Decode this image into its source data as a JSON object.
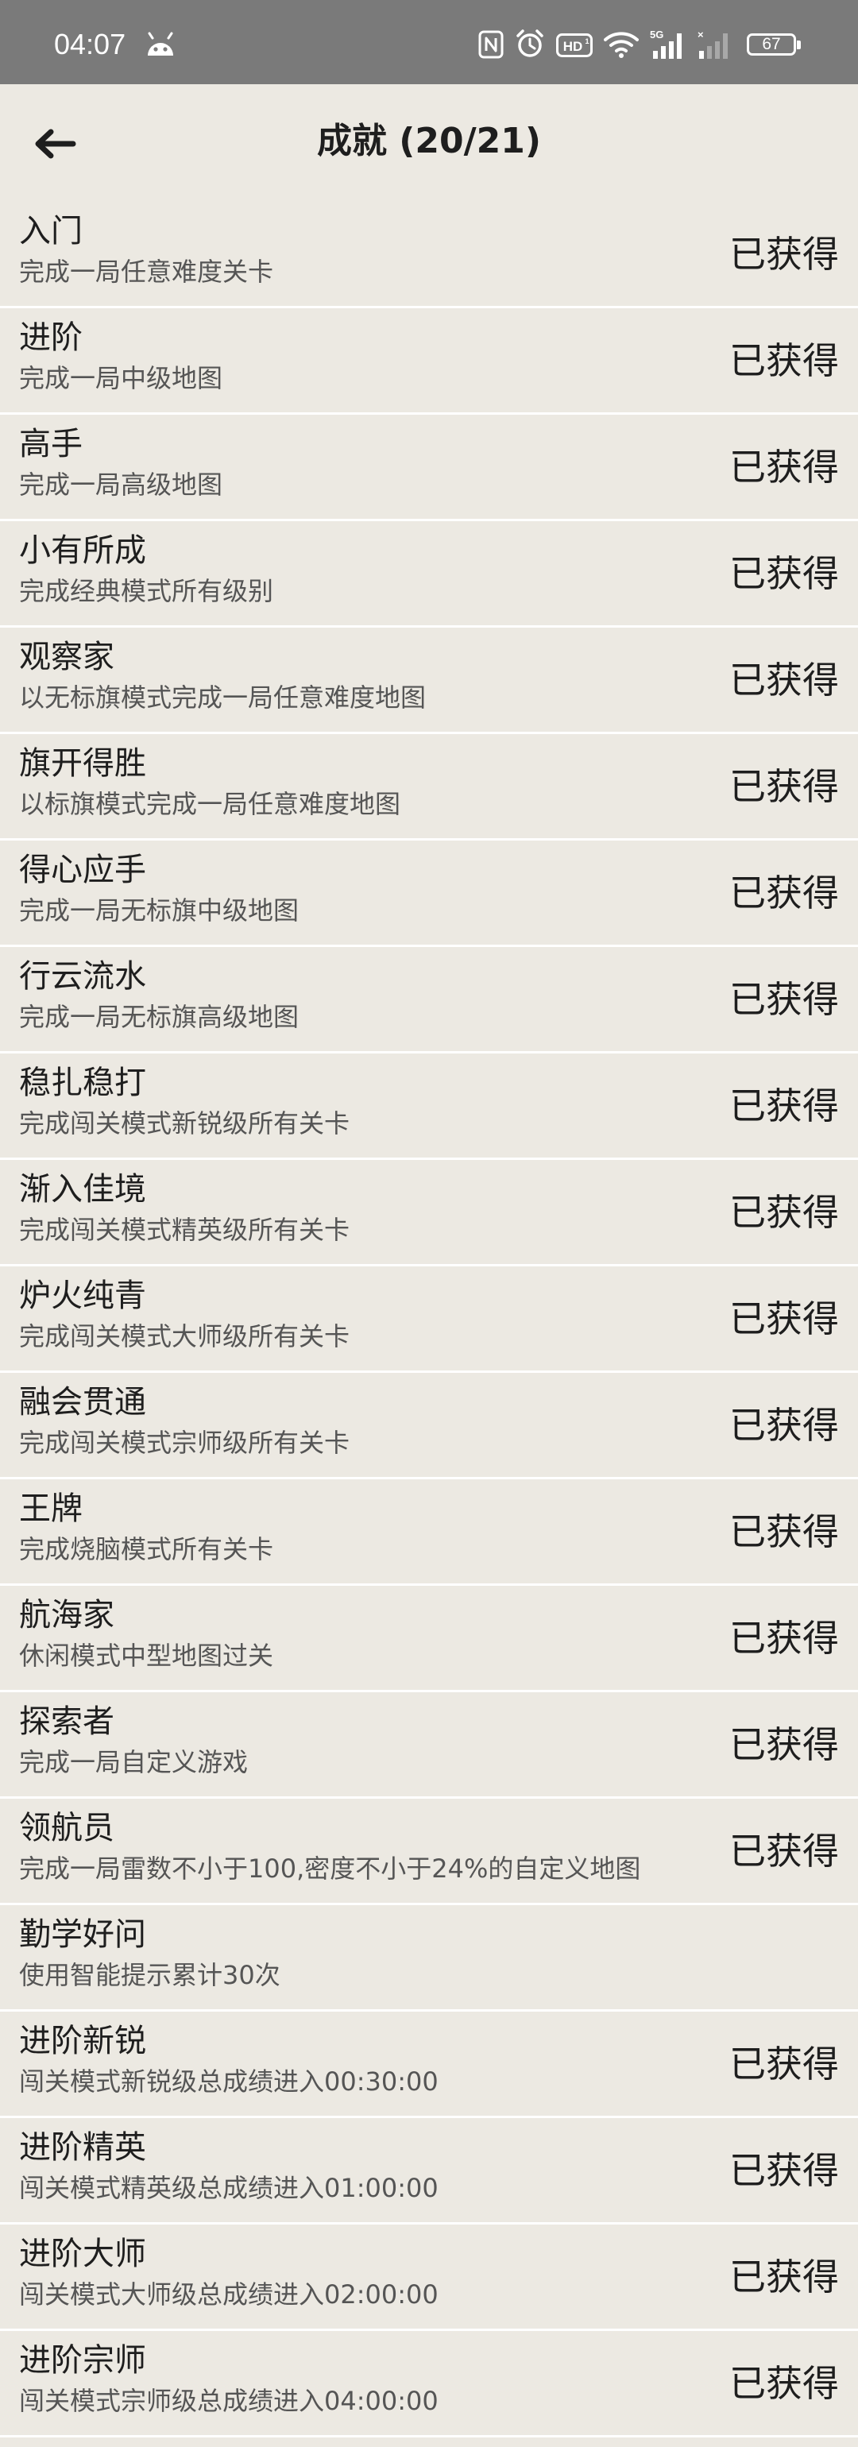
{
  "status_bar": {
    "time": "04:07",
    "battery": "67",
    "icons": [
      "android-icon",
      "nfc-icon",
      "alarm-icon",
      "hd-icon",
      "wifi-icon",
      "signal-5g-icon",
      "signal-icon",
      "battery-icon"
    ]
  },
  "header": {
    "title": "成就 (20/21)",
    "back_icon": "arrow-left-icon"
  },
  "achievements": [
    {
      "name": "入门",
      "desc": "完成一局任意难度关卡",
      "status": "已获得"
    },
    {
      "name": "进阶",
      "desc": "完成一局中级地图",
      "status": "已获得"
    },
    {
      "name": "高手",
      "desc": "完成一局高级地图",
      "status": "已获得"
    },
    {
      "name": "小有所成",
      "desc": "完成经典模式所有级别",
      "status": "已获得"
    },
    {
      "name": "观察家",
      "desc": "以无标旗模式完成一局任意难度地图",
      "status": "已获得"
    },
    {
      "name": "旗开得胜",
      "desc": "以标旗模式完成一局任意难度地图",
      "status": "已获得"
    },
    {
      "name": "得心应手",
      "desc": "完成一局无标旗中级地图",
      "status": "已获得"
    },
    {
      "name": "行云流水",
      "desc": "完成一局无标旗高级地图",
      "status": "已获得"
    },
    {
      "name": "稳扎稳打",
      "desc": "完成闯关模式新锐级所有关卡",
      "status": "已获得"
    },
    {
      "name": "渐入佳境",
      "desc": "完成闯关模式精英级所有关卡",
      "status": "已获得"
    },
    {
      "name": "炉火纯青",
      "desc": "完成闯关模式大师级所有关卡",
      "status": "已获得"
    },
    {
      "name": "融会贯通",
      "desc": "完成闯关模式宗师级所有关卡",
      "status": "已获得"
    },
    {
      "name": "王牌",
      "desc": "完成烧脑模式所有关卡",
      "status": "已获得"
    },
    {
      "name": "航海家",
      "desc": "休闲模式中型地图过关",
      "status": "已获得"
    },
    {
      "name": "探索者",
      "desc": "完成一局自定义游戏",
      "status": "已获得"
    },
    {
      "name": "领航员",
      "desc": "完成一局雷数不小于100,密度不小于24%的自定义地图",
      "status": "已获得"
    },
    {
      "name": "勤学好问",
      "desc": "使用智能提示累计30次",
      "status": ""
    },
    {
      "name": "进阶新锐",
      "desc": "闯关模式新锐级总成绩进入00:30:00",
      "status": "已获得"
    },
    {
      "name": "进阶精英",
      "desc": "闯关模式精英级总成绩进入01:00:00",
      "status": "已获得"
    },
    {
      "name": "进阶大师",
      "desc": "闯关模式大师级总成绩进入02:00:00",
      "status": "已获得"
    },
    {
      "name": "进阶宗师",
      "desc": "闯关模式宗师级总成绩进入04:00:00",
      "status": "已获得"
    }
  ],
  "colors": {
    "background": "#ece9e2",
    "status_bar": "#7a7a7a",
    "divider": "#ffffff",
    "text_primary": "#1e1e1e",
    "text_secondary": "#555555"
  }
}
